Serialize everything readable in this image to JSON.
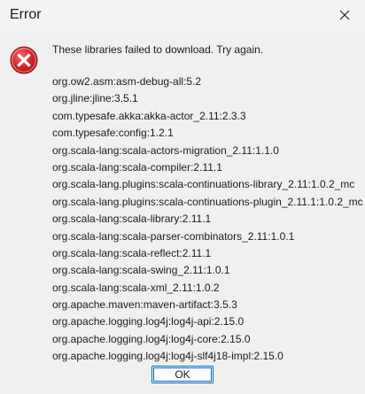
{
  "window": {
    "title": "Error"
  },
  "dialog": {
    "message": "These libraries failed to download. Try again.",
    "libraries": [
      "org.ow2.asm:asm-debug-all:5.2",
      "org.jline:jline:3.5.1",
      "com.typesafe.akka:akka-actor_2.11:2.3.3",
      "com.typesafe:config:1.2.1",
      "org.scala-lang:scala-actors-migration_2.11:1.1.0",
      "org.scala-lang:scala-compiler:2.11.1",
      "org.scala-lang.plugins:scala-continuations-library_2.11:1.0.2_mc",
      "org.scala-lang.plugins:scala-continuations-plugin_2.11.1:1.0.2_mc",
      "org.scala-lang:scala-library:2.11.1",
      "org.scala-lang:scala-parser-combinators_2.11:1.0.1",
      "org.scala-lang:scala-reflect:2.11.1",
      "org.scala-lang:scala-swing_2.11:1.0.1",
      "org.scala-lang:scala-xml_2.11:1.0.2",
      "org.apache.maven:maven-artifact:3.5.3",
      "org.apache.logging.log4j:log4j-api:2.15.0",
      "org.apache.logging.log4j:log4j-core:2.15.0",
      "org.apache.logging.log4j:log4j-slf4j18-impl:2.15.0"
    ],
    "ok_label": "OK",
    "icon": "error-icon"
  },
  "colors": {
    "error_red": "#d7262b",
    "button_border": "#0067c0"
  }
}
